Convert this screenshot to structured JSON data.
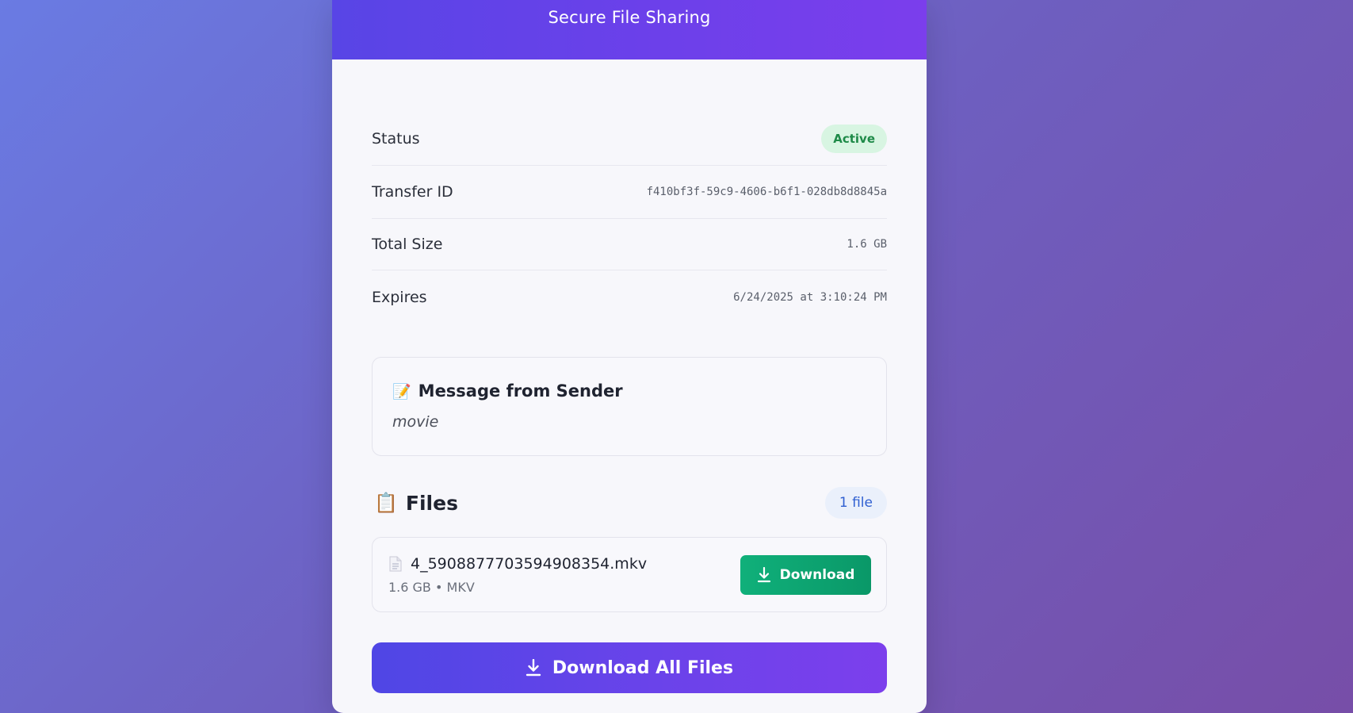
{
  "header": {
    "title": "Secure File Sharing"
  },
  "info": {
    "status_label": "Status",
    "status_value": "Active",
    "transfer_id_label": "Transfer ID",
    "transfer_id_value": "f410bf3f-59c9-4606-b6f1-028db8d8845a",
    "total_size_label": "Total Size",
    "total_size_value": "1.6 GB",
    "expires_label": "Expires",
    "expires_value": "6/24/2025 at 3:10:24 PM"
  },
  "message": {
    "icon": "memo-icon",
    "emoji": "📝",
    "title": "Message from Sender",
    "text": "movie"
  },
  "files": {
    "icon": "clipboard-icon",
    "emoji": "📋",
    "title": "Files",
    "count": "1 file",
    "items": [
      {
        "icon": "document-icon",
        "name": "4_5908877703594908354.mkv",
        "meta": "1.6 GB • MKV",
        "download_label": "Download"
      }
    ]
  },
  "download_all": {
    "icon": "download-icon",
    "label": "Download All Files"
  },
  "colors": {
    "accent": "#5a45e6",
    "success": "#10b07a",
    "status_active_bg": "#d8f5e2",
    "status_active_text": "#1e8a48"
  }
}
